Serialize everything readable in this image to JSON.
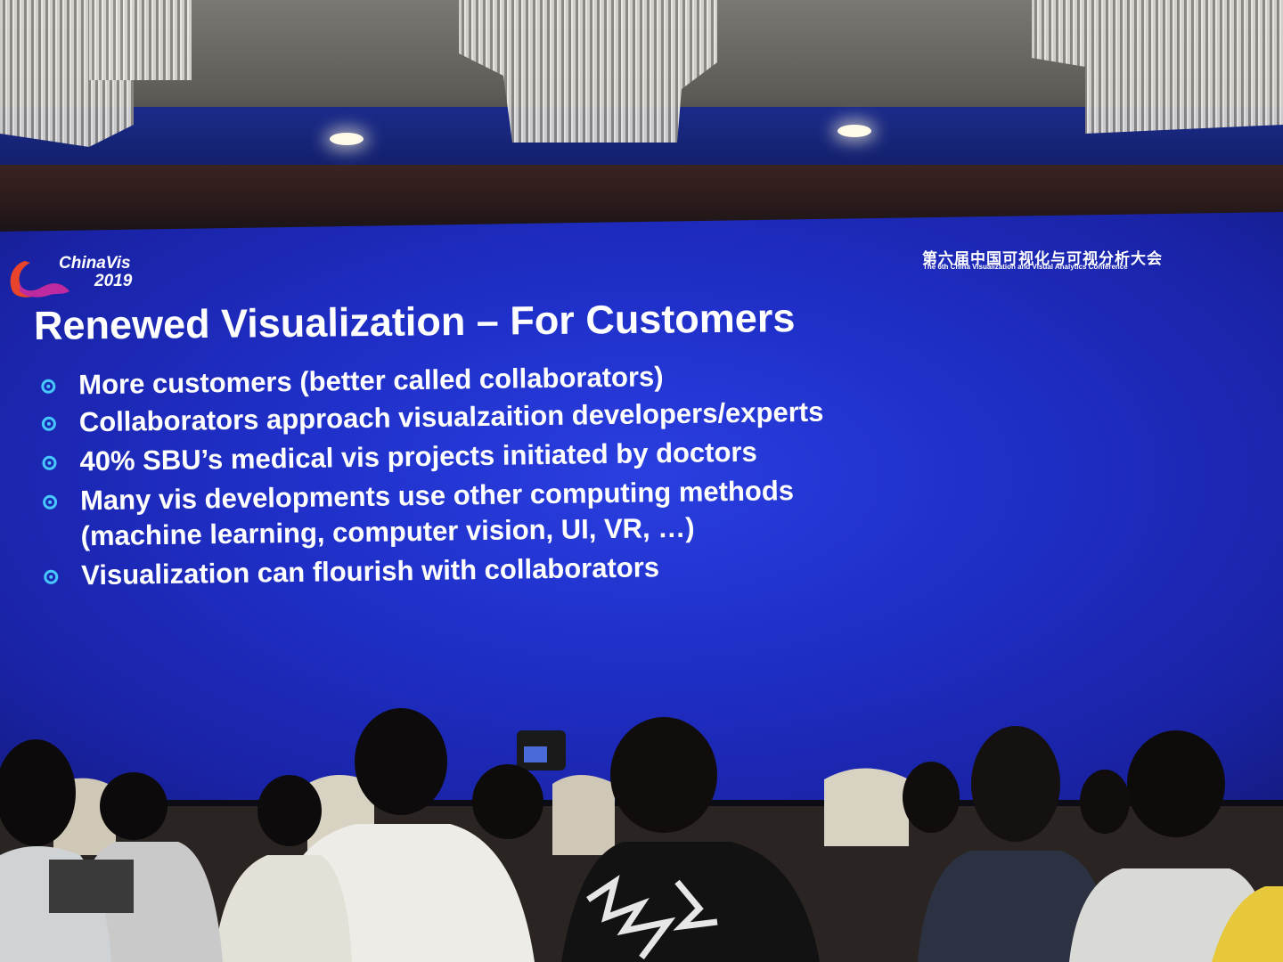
{
  "logo": {
    "name": "ChinaVis",
    "year": "2019"
  },
  "conference": {
    "title_cn": "第六届中国可视化与可视分析大会",
    "title_en": "The 6th China Visualization and Visual Analytics Conference"
  },
  "slide": {
    "title": "Renewed Visualization – For Customers",
    "bullets": [
      {
        "text": "More customers (better called collaborators)"
      },
      {
        "text": "Collaborators approach visualzaition developers/experts"
      },
      {
        "text": "40% SBU’s medical vis projects initiated by doctors"
      },
      {
        "text": "Many vis developments use other computing methods",
        "text2": "(machine learning, computer vision, UI, VR, …)"
      },
      {
        "text": "Visualization can flourish with collaborators"
      }
    ]
  },
  "colors": {
    "screen_blue": "#1f2fc8",
    "bullet_cyan": "#46c8ff",
    "text": "#ffffff"
  }
}
